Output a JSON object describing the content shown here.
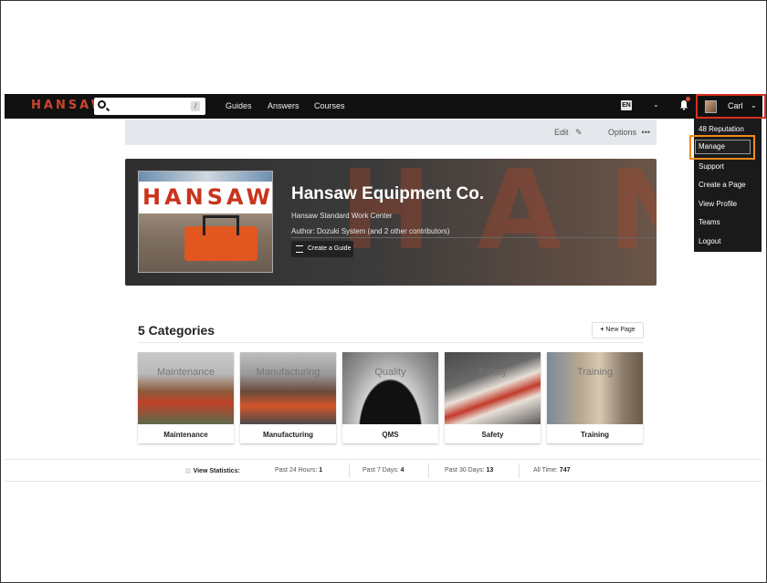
{
  "brand": {
    "logo_text": "HANSAW",
    "accent": "#c9462d"
  },
  "navbar": {
    "search_placeholder": "",
    "search_shortcut": "/",
    "links": [
      "Guides",
      "Answers",
      "Courses"
    ],
    "language": "EN",
    "user_name": "Carl"
  },
  "toolbar": {
    "edit_label": "Edit",
    "options_label": "Options"
  },
  "user_menu": {
    "reputation": "48 Reputation",
    "items": [
      "Manage",
      "Support",
      "Create a Page",
      "View Profile",
      "Teams",
      "Logout"
    ]
  },
  "hero": {
    "bg_text": "HANSAW",
    "logo_text": "HANSAW",
    "title": "Hansaw Equipment Co.",
    "subtitle": "Hansaw Standard Work Center",
    "author": "Author: Dozuki System (and 2 other contributors)",
    "create_guide_label": "Create a Guide"
  },
  "categories": {
    "heading": "5 Categories",
    "new_page_label": "New Page",
    "items": [
      {
        "image_label": "Maintenance",
        "name": "Maintenance"
      },
      {
        "image_label": "Manufacturing",
        "name": "Manufacturing"
      },
      {
        "image_label": "Quality",
        "name": "QMS"
      },
      {
        "image_label": "Safety",
        "name": "Safety"
      },
      {
        "image_label": "Training",
        "name": "Training"
      }
    ]
  },
  "stats": {
    "label": "View Statistics:",
    "past24_label": "Past 24 Hours:",
    "past24_value": "1",
    "past7_label": "Past 7 Days:",
    "past7_value": "4",
    "past30_label": "Past 30 Days:",
    "past30_value": "13",
    "all_label": "All Time:",
    "all_value": "747"
  },
  "highlight_colors": {
    "user_button": "#d6301f",
    "manage_item": "#f08a1c"
  }
}
